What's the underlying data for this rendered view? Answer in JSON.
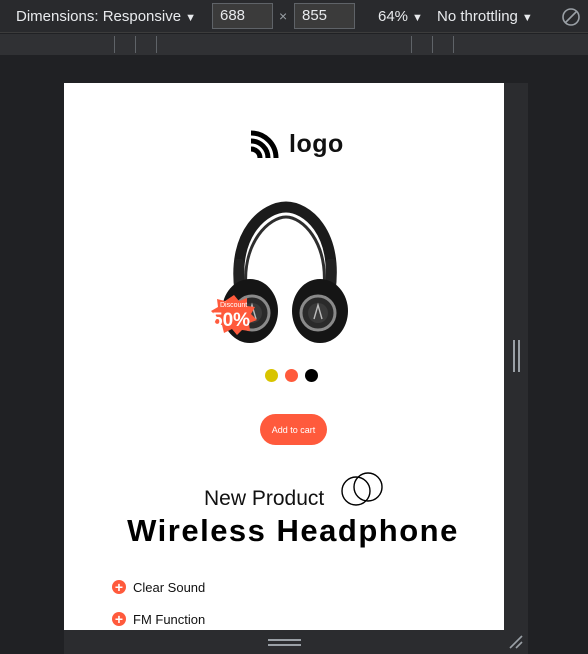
{
  "devtools": {
    "dimensions_label": "Dimensions: Responsive",
    "width": "688",
    "height": "855",
    "times": "×",
    "zoom": "64%",
    "throttling": "No throttling",
    "caret": "▼"
  },
  "page": {
    "logo_text": "logo",
    "badge_small": "Discount",
    "badge_big": "50%",
    "color_options": [
      {
        "name": "yellow",
        "color": "#d8c400"
      },
      {
        "name": "orange",
        "color": "#ff5a3c"
      },
      {
        "name": "black",
        "color": "#000000"
      }
    ],
    "add_to_cart": "Add to cart",
    "new_product": "New Product",
    "title": "Wireless Headphone",
    "features": [
      "Clear Sound",
      "FM Function"
    ],
    "accent_color": "#ff5a3c"
  }
}
